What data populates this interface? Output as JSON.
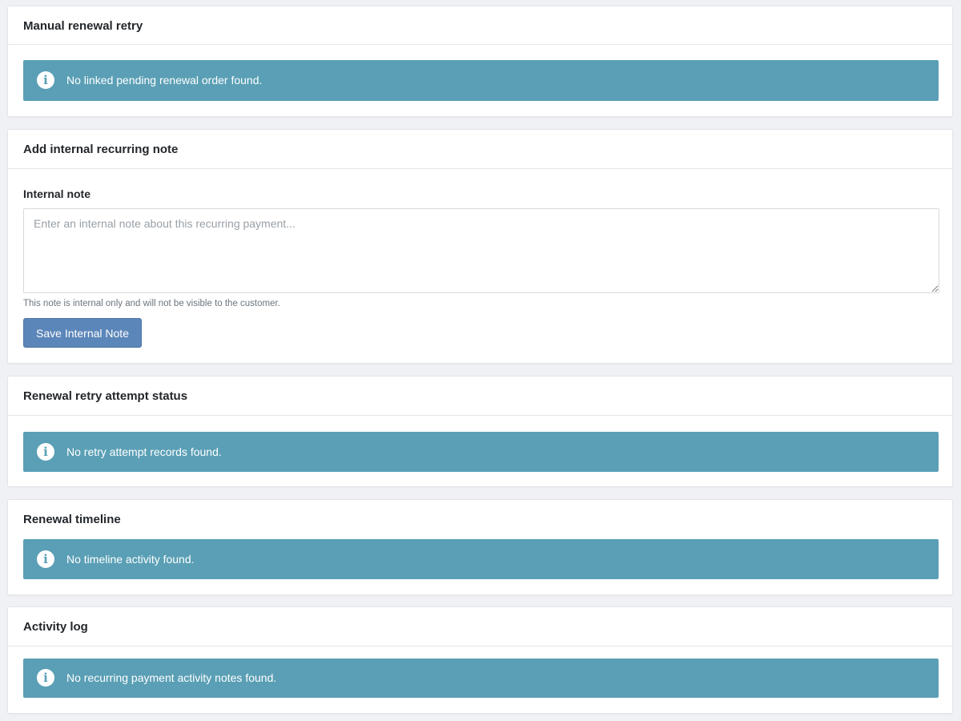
{
  "sections": {
    "manual_retry": {
      "title": "Manual renewal retry",
      "alert": "No linked pending renewal order found."
    },
    "internal_note": {
      "title": "Add internal recurring note",
      "field_label": "Internal note",
      "placeholder": "Enter an internal note about this recurring payment...",
      "value": "",
      "help_text": "This note is internal only and will not be visible to the customer.",
      "save_label": "Save Internal Note"
    },
    "retry_status": {
      "title": "Renewal retry attempt status",
      "alert": "No retry attempt records found."
    },
    "timeline": {
      "title": "Renewal timeline",
      "alert": "No timeline activity found."
    },
    "activity_log": {
      "title": "Activity log",
      "alert": "No recurring payment activity notes found."
    }
  },
  "icons": {
    "info": "info-circle-icon"
  },
  "colors": {
    "page_background": "#f0f1f5",
    "info_alert": "#5a9fb5",
    "primary_button": "#5b86b9"
  }
}
